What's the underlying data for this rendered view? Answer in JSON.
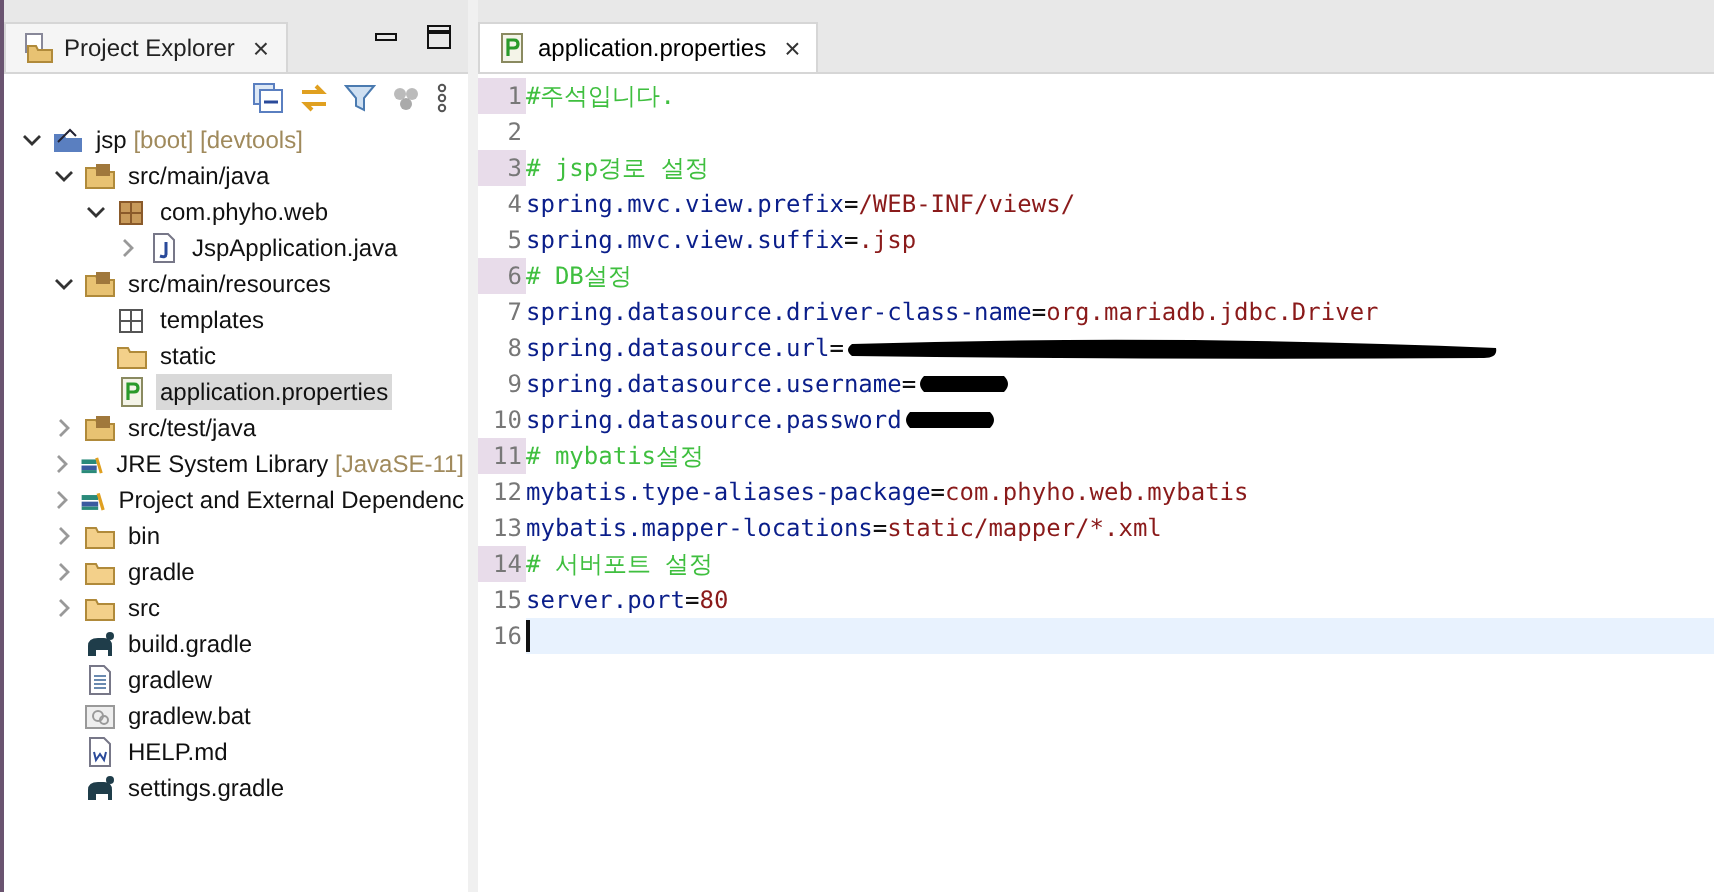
{
  "explorer": {
    "title": "Project Explorer",
    "close": "×",
    "tree": [
      {
        "label": "jsp",
        "decoration": "[boot] [devtools]",
        "kind": "project",
        "expanded": true,
        "selected": false,
        "children": [
          {
            "label": "src/main/java",
            "kind": "srcfolder",
            "expanded": true,
            "selected": false,
            "children": [
              {
                "label": "com.phyho.web",
                "kind": "package",
                "expanded": true,
                "selected": false,
                "children": [
                  {
                    "label": "JspApplication.java",
                    "kind": "java",
                    "expanded": false,
                    "selected": false
                  }
                ]
              }
            ]
          },
          {
            "label": "src/main/resources",
            "kind": "srcfolder",
            "expanded": true,
            "selected": false,
            "children": [
              {
                "label": "templates",
                "kind": "emptypackage",
                "selected": false
              },
              {
                "label": "static",
                "kind": "folder",
                "selected": false
              },
              {
                "label": "application.properties",
                "kind": "properties",
                "selected": true
              }
            ]
          },
          {
            "label": "src/test/java",
            "kind": "srcfolder",
            "expanded": false,
            "selected": false
          },
          {
            "label": "JRE System Library",
            "decoration": "[JavaSE-11]",
            "kind": "library",
            "expanded": false,
            "selected": false
          },
          {
            "label": "Project and External Dependenc",
            "kind": "library",
            "expanded": false,
            "selected": false
          },
          {
            "label": "bin",
            "kind": "folder",
            "expanded": false,
            "selected": false
          },
          {
            "label": "gradle",
            "kind": "folder",
            "expanded": false,
            "selected": false
          },
          {
            "label": "src",
            "kind": "folder",
            "expanded": false,
            "selected": false
          },
          {
            "label": "build.gradle",
            "kind": "gradle",
            "selected": false
          },
          {
            "label": "gradlew",
            "kind": "textfile",
            "selected": false
          },
          {
            "label": "gradlew.bat",
            "kind": "batfile",
            "selected": false
          },
          {
            "label": "HELP.md",
            "kind": "doc",
            "selected": false
          },
          {
            "label": "settings.gradle",
            "kind": "gradle",
            "selected": false
          }
        ]
      }
    ]
  },
  "editor": {
    "tab": {
      "title": "application.properties",
      "close": "×",
      "selected": true
    },
    "lines": [
      {
        "number": "1",
        "kind": "comment",
        "text": "#주석입니다."
      },
      {
        "number": "2",
        "kind": "blank"
      },
      {
        "number": "3",
        "kind": "comment",
        "text": "# jsp경로 설정"
      },
      {
        "number": "4",
        "kind": "property",
        "key": "spring.mvc.view.prefix",
        "eq": "=",
        "value": "/WEB-INF/views/"
      },
      {
        "number": "5",
        "kind": "property",
        "key": "spring.mvc.view.suffix",
        "eq": "=",
        "value": ".jsp"
      },
      {
        "number": "6",
        "kind": "comment",
        "text": "# DB설정"
      },
      {
        "number": "7",
        "kind": "property",
        "key": "spring.datasource.driver-class-name",
        "eq": "=",
        "value": "org.mariadb.jdbc.Driver"
      },
      {
        "number": "8",
        "kind": "longredacted",
        "key": "spring.datasource.url",
        "eq": "="
      },
      {
        "number": "9",
        "kind": "redacted",
        "key": "spring.datasource.username",
        "eq": "="
      },
      {
        "number": "10",
        "kind": "redacted",
        "key": "spring.datasource.password"
      },
      {
        "number": "11",
        "kind": "comment",
        "text": "# mybatis설정"
      },
      {
        "number": "12",
        "kind": "property",
        "key": "mybatis.type-aliases-package",
        "eq": "=",
        "value": "com.phyho.web.mybatis"
      },
      {
        "number": "13",
        "kind": "property",
        "key": "mybatis.mapper-locations",
        "eq": "=",
        "value": "static/mapper/*.xml"
      },
      {
        "number": "14",
        "kind": "comment",
        "text": "# 서버포트 설정"
      },
      {
        "number": "15",
        "kind": "property",
        "key": "server.port",
        "eq": "=",
        "value": "80"
      },
      {
        "number": "16",
        "kind": "blank",
        "current": true
      }
    ]
  }
}
